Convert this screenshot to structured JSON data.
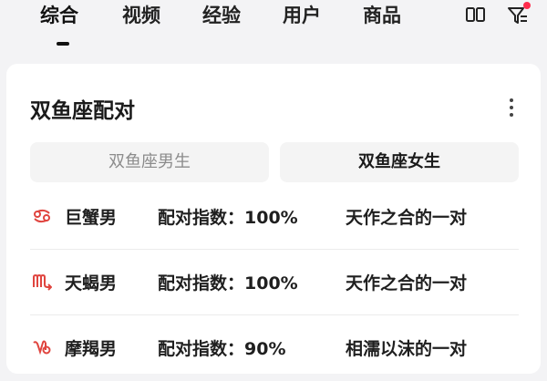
{
  "tabs": [
    {
      "label": "综合",
      "active": true
    },
    {
      "label": "视频",
      "active": false
    },
    {
      "label": "经验",
      "active": false
    },
    {
      "label": "用户",
      "active": false
    },
    {
      "label": "商品",
      "active": false
    }
  ],
  "nav_icons": {
    "layout": "dual-column-icon",
    "filter": "filter-icon",
    "filter_has_badge": true
  },
  "card": {
    "title": "双鱼座配对",
    "more": "more-vertical-icon",
    "segments": [
      {
        "label": "双鱼座男生",
        "selected": false
      },
      {
        "label": "双鱼座女生",
        "selected": true
      }
    ],
    "rows": [
      {
        "icon": "cancer-symbol-icon",
        "name": "巨蟹男",
        "score_label": "配对指数：",
        "score": "100%",
        "desc": "天作之合的一对"
      },
      {
        "icon": "scorpio-symbol-icon",
        "name": "天蝎男",
        "score_label": "配对指数：",
        "score": "100%",
        "desc": "天作之合的一对"
      },
      {
        "icon": "capricorn-symbol-icon",
        "name": "摩羯男",
        "score_label": "配对指数：",
        "score": "90%",
        "desc": "相濡以沫的一对"
      }
    ]
  },
  "colors": {
    "accent_red": "#e0453f",
    "badge_red": "#ff2d4d",
    "text": "#1f1f1f",
    "muted": "#8c8c8c"
  }
}
